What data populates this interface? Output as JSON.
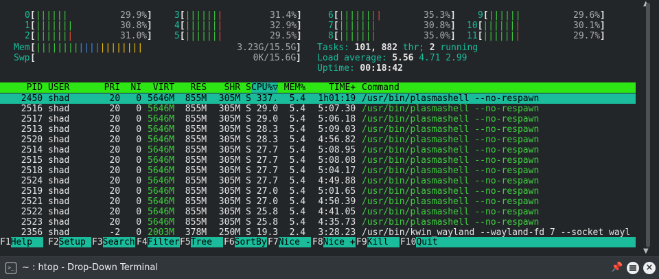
{
  "cpus": [
    {
      "id": "0",
      "bar_g": "||||||",
      "bar_r": "",
      "pct": "29.9%"
    },
    {
      "id": "1",
      "bar_g": "|||||||",
      "bar_r": "",
      "pct": "30.8%"
    },
    {
      "id": "2",
      "bar_g": "||||||",
      "bar_r": "|",
      "pct": "31.0%"
    },
    {
      "id": "3",
      "bar_g": "||||||",
      "bar_r": "|",
      "pct": "31.4%"
    },
    {
      "id": "4",
      "bar_g": "||||||",
      "bar_r": "|",
      "pct": "32.9%"
    },
    {
      "id": "5",
      "bar_g": "||||||",
      "bar_r": "|",
      "pct": "29.5%"
    },
    {
      "id": "6",
      "bar_g": "||||||",
      "bar_r": "||",
      "pct": "35.3%"
    },
    {
      "id": "7",
      "bar_g": "||||||",
      "bar_r": "|",
      "pct": "30.8%"
    },
    {
      "id": "8",
      "bar_g": "||||||",
      "bar_r": "|",
      "pct": "35.0%"
    },
    {
      "id": "9",
      "bar_g": "||||||",
      "bar_r": "",
      "pct": "29.6%"
    },
    {
      "id": "10",
      "bar_g": "||||||",
      "bar_r": "|",
      "pct": "30.1%"
    },
    {
      "id": "11",
      "bar_g": "||||||",
      "bar_r": "|",
      "pct": "29.7%"
    }
  ],
  "mem": {
    "label": "Mem",
    "bar_g": "||||||||",
    "bar_b": "||||",
    "bar_y": "||||||||",
    "value": "3.23G/15.5G"
  },
  "swp": {
    "label": "Swp",
    "value": "0K/15.6G"
  },
  "tasks": {
    "label": "Tasks:",
    "count": "101,",
    "thr": "882",
    "thr_label": "thr;",
    "running": "2",
    "running_label": "running"
  },
  "load": {
    "label": "Load average:",
    "l1": "5.56",
    "l5": "4.71",
    "l15": "2.99"
  },
  "uptime": {
    "label": "Uptime:",
    "value": "00:18:42"
  },
  "columns": {
    "pid": "PID",
    "user": "USER",
    "pri": "PRI",
    "ni": "NI",
    "virt": "VIRT",
    "res": "RES",
    "shr": "SHR",
    "s": "S",
    "cpu": "CPU%▽",
    "mem": "MEM%",
    "time": "TIME+",
    "cmd": "Command"
  },
  "processes": [
    {
      "pid": "2450",
      "user": "shad",
      "pri": "20",
      "ni": "0",
      "virt": "5646M",
      "res": "855M",
      "shr": "305M",
      "s": "S",
      "cpu": "337.",
      "mem": "5.4",
      "time": "1h01:19",
      "cmd": "/usr/bin/plasmashell --no-respawn"
    },
    {
      "pid": "2516",
      "user": "shad",
      "pri": "20",
      "ni": "0",
      "virt": "5646M",
      "res": "855M",
      "shr": "305M",
      "s": "S",
      "cpu": "29.0",
      "mem": "5.4",
      "time": "5:07.30",
      "cmd": "/usr/bin/plasmashell --no-respawn"
    },
    {
      "pid": "2517",
      "user": "shad",
      "pri": "20",
      "ni": "0",
      "virt": "5646M",
      "res": "855M",
      "shr": "305M",
      "s": "S",
      "cpu": "29.0",
      "mem": "5.4",
      "time": "5:06.18",
      "cmd": "/usr/bin/plasmashell --no-respawn"
    },
    {
      "pid": "2513",
      "user": "shad",
      "pri": "20",
      "ni": "0",
      "virt": "5646M",
      "res": "855M",
      "shr": "305M",
      "s": "S",
      "cpu": "28.3",
      "mem": "5.4",
      "time": "5:09.03",
      "cmd": "/usr/bin/plasmashell --no-respawn"
    },
    {
      "pid": "2520",
      "user": "shad",
      "pri": "20",
      "ni": "0",
      "virt": "5646M",
      "res": "855M",
      "shr": "305M",
      "s": "S",
      "cpu": "28.3",
      "mem": "5.4",
      "time": "4:56.82",
      "cmd": "/usr/bin/plasmashell --no-respawn"
    },
    {
      "pid": "2514",
      "user": "shad",
      "pri": "20",
      "ni": "0",
      "virt": "5646M",
      "res": "855M",
      "shr": "305M",
      "s": "S",
      "cpu": "27.7",
      "mem": "5.4",
      "time": "5:08.95",
      "cmd": "/usr/bin/plasmashell --no-respawn"
    },
    {
      "pid": "2515",
      "user": "shad",
      "pri": "20",
      "ni": "0",
      "virt": "5646M",
      "res": "855M",
      "shr": "305M",
      "s": "S",
      "cpu": "27.7",
      "mem": "5.4",
      "time": "5:08.08",
      "cmd": "/usr/bin/plasmashell --no-respawn"
    },
    {
      "pid": "2518",
      "user": "shad",
      "pri": "20",
      "ni": "0",
      "virt": "5646M",
      "res": "855M",
      "shr": "305M",
      "s": "S",
      "cpu": "27.7",
      "mem": "5.4",
      "time": "5:04.17",
      "cmd": "/usr/bin/plasmashell --no-respawn"
    },
    {
      "pid": "2524",
      "user": "shad",
      "pri": "20",
      "ni": "0",
      "virt": "5646M",
      "res": "855M",
      "shr": "305M",
      "s": "S",
      "cpu": "27.7",
      "mem": "5.4",
      "time": "4:49.88",
      "cmd": "/usr/bin/plasmashell --no-respawn"
    },
    {
      "pid": "2519",
      "user": "shad",
      "pri": "20",
      "ni": "0",
      "virt": "5646M",
      "res": "855M",
      "shr": "305M",
      "s": "S",
      "cpu": "27.0",
      "mem": "5.4",
      "time": "5:01.65",
      "cmd": "/usr/bin/plasmashell --no-respawn"
    },
    {
      "pid": "2521",
      "user": "shad",
      "pri": "20",
      "ni": "0",
      "virt": "5646M",
      "res": "855M",
      "shr": "305M",
      "s": "S",
      "cpu": "27.0",
      "mem": "5.4",
      "time": "4:50.39",
      "cmd": "/usr/bin/plasmashell --no-respawn"
    },
    {
      "pid": "2522",
      "user": "shad",
      "pri": "20",
      "ni": "0",
      "virt": "5646M",
      "res": "855M",
      "shr": "305M",
      "s": "S",
      "cpu": "25.8",
      "mem": "5.4",
      "time": "4:41.05",
      "cmd": "/usr/bin/plasmashell --no-respawn"
    },
    {
      "pid": "2523",
      "user": "shad",
      "pri": "20",
      "ni": "0",
      "virt": "5646M",
      "res": "855M",
      "shr": "305M",
      "s": "S",
      "cpu": "25.8",
      "mem": "5.4",
      "time": "4:35.73",
      "cmd": "/usr/bin/plasmashell --no-respawn"
    },
    {
      "pid": "2356",
      "user": "shad",
      "pri": "-2",
      "ni": "0",
      "virt": "2003M",
      "res": "378M",
      "shr": "250M",
      "s": "S",
      "cpu": "19.3",
      "mem": "2.4",
      "time": "3:28.23",
      "cmd": "/usr/bin/kwin_wayland --wayland-fd 7 --socket wayl"
    }
  ],
  "fkeys": [
    {
      "key": "F1",
      "label": "Help  "
    },
    {
      "key": "F2",
      "label": "Setup "
    },
    {
      "key": "F3",
      "label": "Search"
    },
    {
      "key": "F4",
      "label": "Filter"
    },
    {
      "key": "F5",
      "label": "Tree  "
    },
    {
      "key": "F6",
      "label": "SortBy"
    },
    {
      "key": "F7",
      "label": "Nice -"
    },
    {
      "key": "F8",
      "label": "Nice +"
    },
    {
      "key": "F9",
      "label": "Kill  "
    },
    {
      "key": "F10",
      "label": "Quit"
    }
  ],
  "window": {
    "title": "~ : htop - Drop-Down Terminal",
    "terminal_icon": ">_"
  },
  "colors": {
    "bg": "#232629",
    "accent": "#1abc9c",
    "header_green": "#2ee614",
    "text_green": "#3fcf3f"
  }
}
